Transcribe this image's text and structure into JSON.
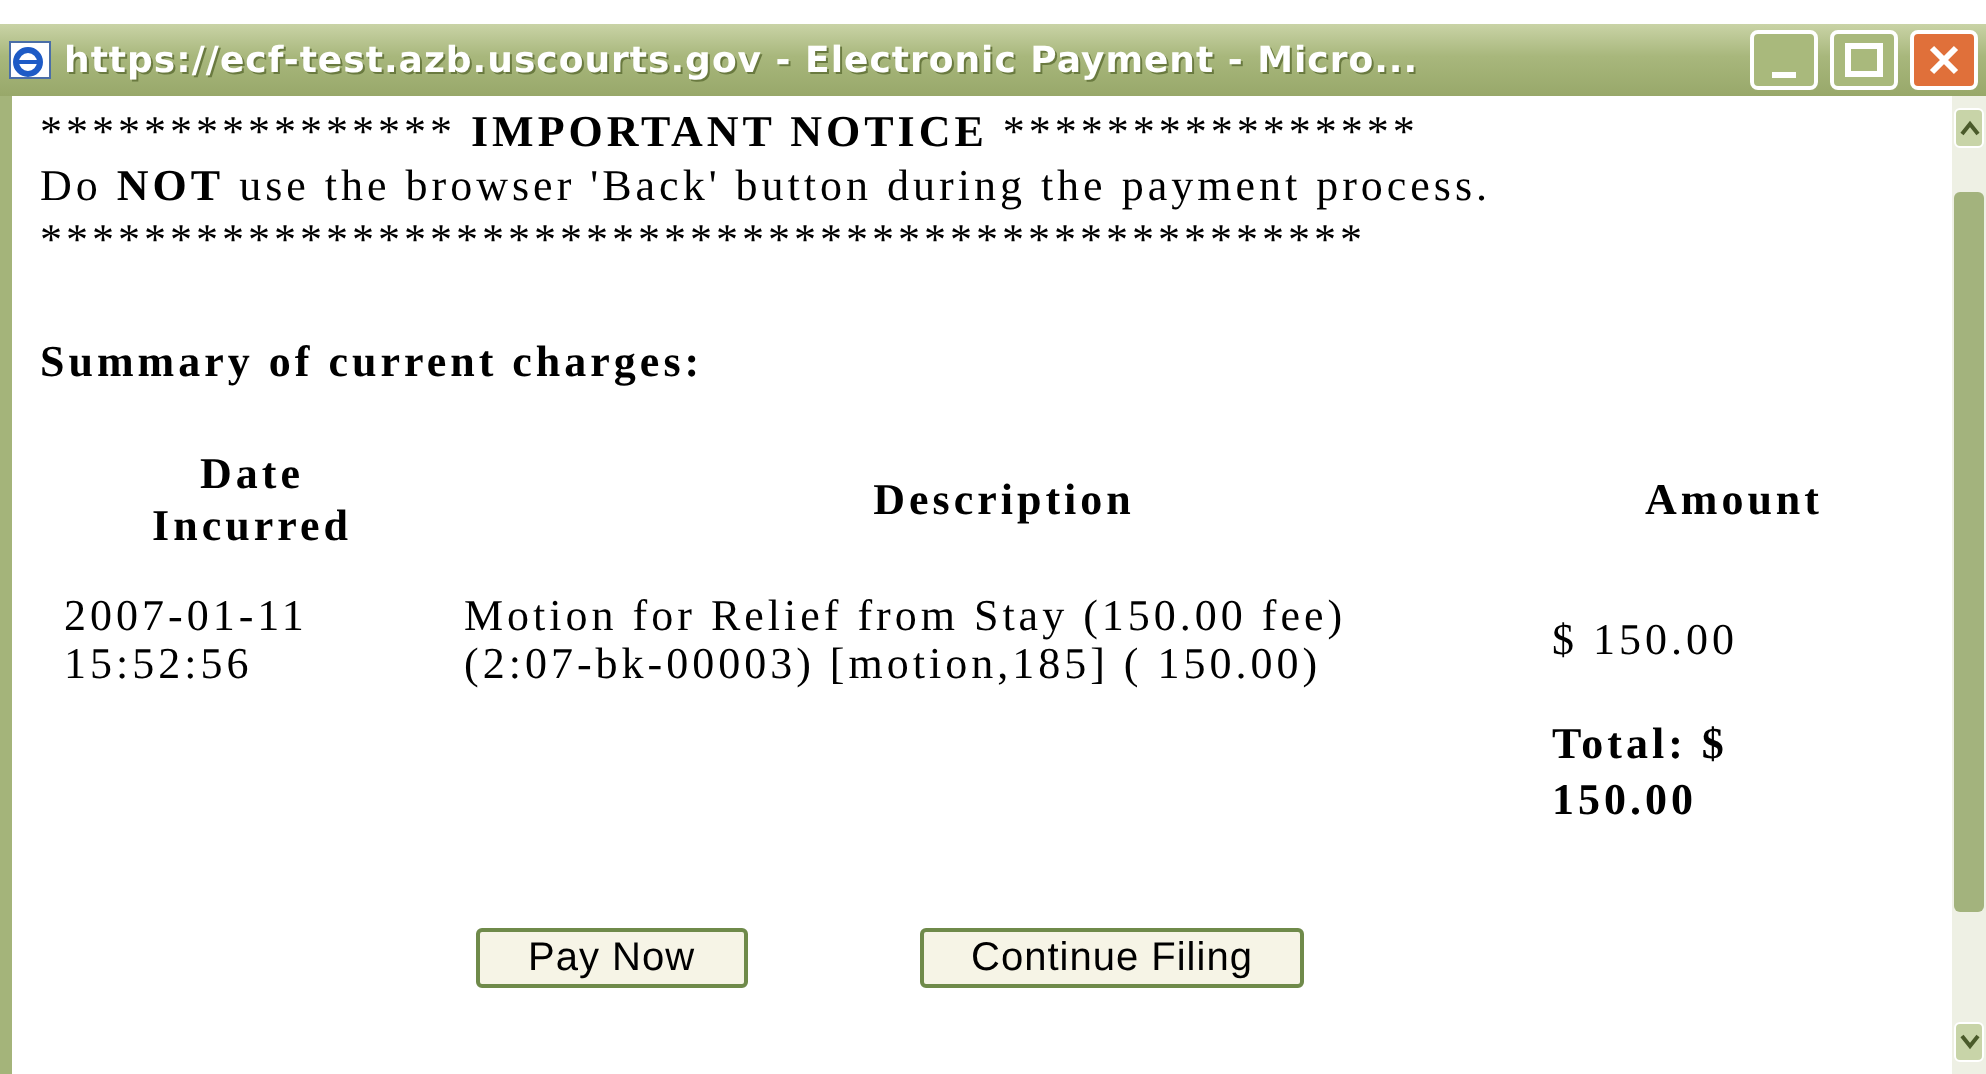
{
  "window": {
    "title": "https://ecf-test.azb.uscourts.gov - Electronic Payment - Micro..."
  },
  "notice": {
    "stars_left": "****************",
    "heading": "IMPORTANT NOTICE",
    "stars_right": "****************",
    "warning": "Do **NOT** use the browser 'Back' button during the payment process.",
    "stars_line": "***************************************************"
  },
  "summary_heading": "Summary of current charges:",
  "table": {
    "columns": [
      "Date Incurred",
      "Description",
      "Amount"
    ],
    "rows": [
      [
        "2007-01-11 15:52:56",
        "Motion for Relief from Stay (150.00 fee)(2:07-bk-00003) [motion,185] ( 150.00)",
        "$ 150.00"
      ]
    ],
    "total": "Total: $ 150.00"
  },
  "buttons": [
    "Pay Now",
    "Continue Filing"
  ]
}
